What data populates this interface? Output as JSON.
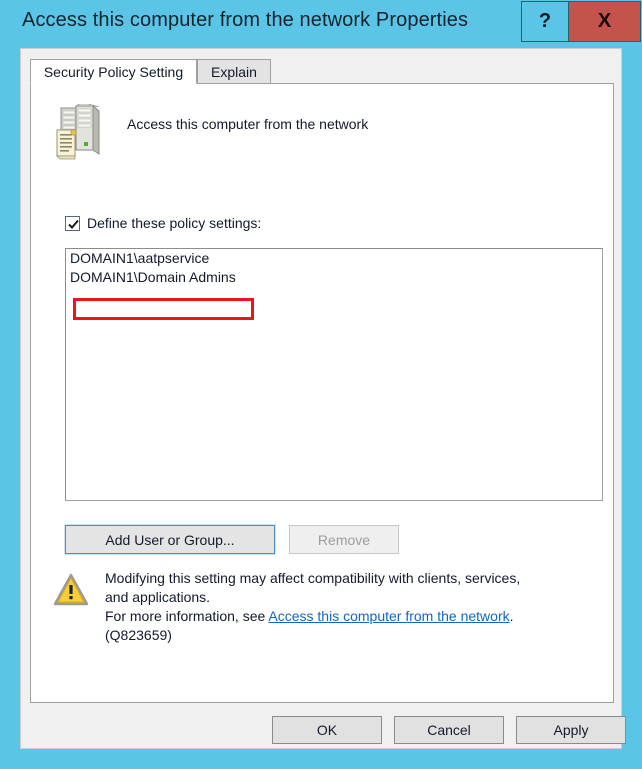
{
  "window": {
    "title": "Access this computer from the network Properties",
    "titlebar_color": "#5bc5e8",
    "close_color": "#c4534b",
    "help_label": "?",
    "close_label": "X"
  },
  "tabs": [
    {
      "label": "Security Policy Setting",
      "active": true
    },
    {
      "label": "Explain",
      "active": false
    }
  ],
  "policy": {
    "icon": "server-policy-icon",
    "name": "Access this computer from the network"
  },
  "define_setting": {
    "label": "Define these policy settings:",
    "checked": true
  },
  "list": {
    "items": [
      "DOMAIN1\\aatpservice",
      "DOMAIN1\\Domain Admins"
    ],
    "annotated_index": 0,
    "annotation_color": "#e8161a"
  },
  "actions": {
    "add_label": "Add User or Group...",
    "remove_label": "Remove",
    "remove_enabled": false
  },
  "warning": {
    "icon": "warning-triangle-icon",
    "line1": "Modifying this setting may affect compatibility with clients, services,",
    "line2": "and applications.",
    "line3_prefix": "For more information, see ",
    "link_text": "Access this computer from the network",
    "line3_suffix": ".",
    "line4": "(Q823659)",
    "link_color": "#1763c6"
  },
  "footer": {
    "ok_label": "OK",
    "cancel_label": "Cancel",
    "apply_label": "Apply"
  }
}
